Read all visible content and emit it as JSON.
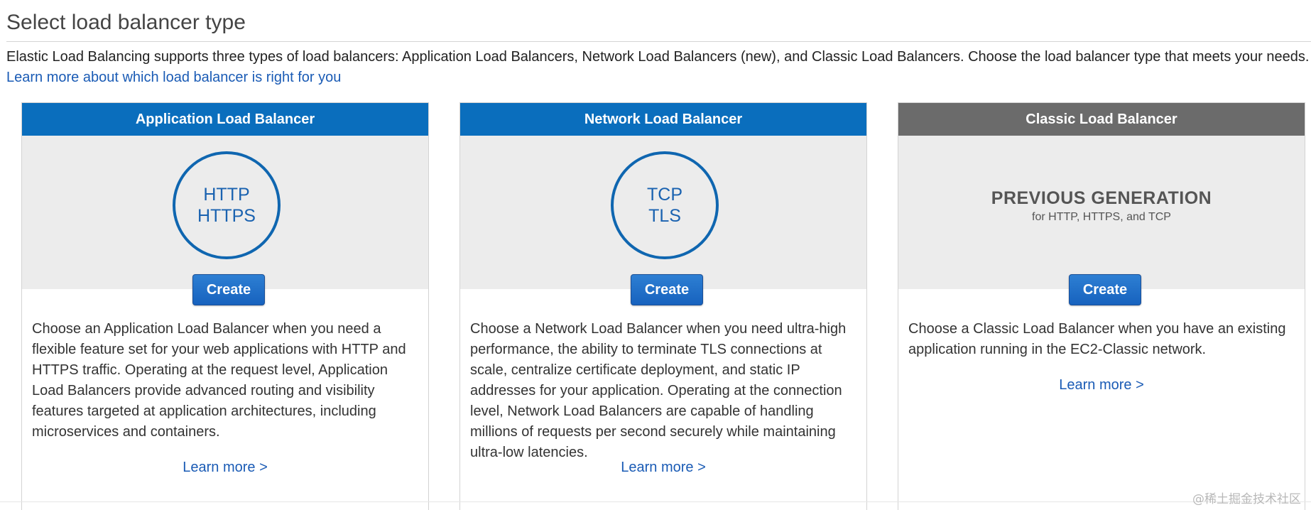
{
  "page": {
    "title": "Select load balancer type",
    "intro_text": "Elastic Load Balancing supports three types of load balancers: Application Load Balancers, Network Load Balancers (new), and Classic Load Balancers. Choose the load balancer type that meets your needs. ",
    "intro_link": "Learn more about which load balancer is right for you"
  },
  "cards": [
    {
      "header": "Application Load Balancer",
      "protocol_line1": "HTTP",
      "protocol_line2": "HTTPS",
      "create_label": "Create",
      "description": "Choose an Application Load Balancer when you need a flexible feature set for your web applications with HTTP and HTTPS traffic. Operating at the request level, Application Load Balancers provide advanced routing and visibility features targeted at application architectures, including microservices and containers.",
      "learn_more": "Learn more >"
    },
    {
      "header": "Network Load Balancer",
      "protocol_line1": "TCP",
      "protocol_line2": "TLS",
      "create_label": "Create",
      "description": "Choose a Network Load Balancer when you need ultra-high performance, the ability to terminate TLS connections at scale, centralize certificate deployment, and static IP addresses for your application. Operating at the connection level, Network Load Balancers are capable of handling millions of requests per second securely while maintaining ultra-low latencies.",
      "learn_more": "Learn more >"
    },
    {
      "header": "Classic Load Balancer",
      "generation_title": "PREVIOUS GENERATION",
      "generation_sub": "for HTTP, HTTPS, and TCP",
      "create_label": "Create",
      "description": "Choose a Classic Load Balancer when you have an existing application running in the EC2-Classic network.",
      "learn_more": "Learn more >"
    }
  ],
  "watermark": "@稀土掘金技术社区",
  "colors": {
    "header_blue": "#0a6ebd",
    "header_gray": "#6b6b6b",
    "link_blue": "#1a5bb5",
    "button_blue": "#1762be"
  }
}
